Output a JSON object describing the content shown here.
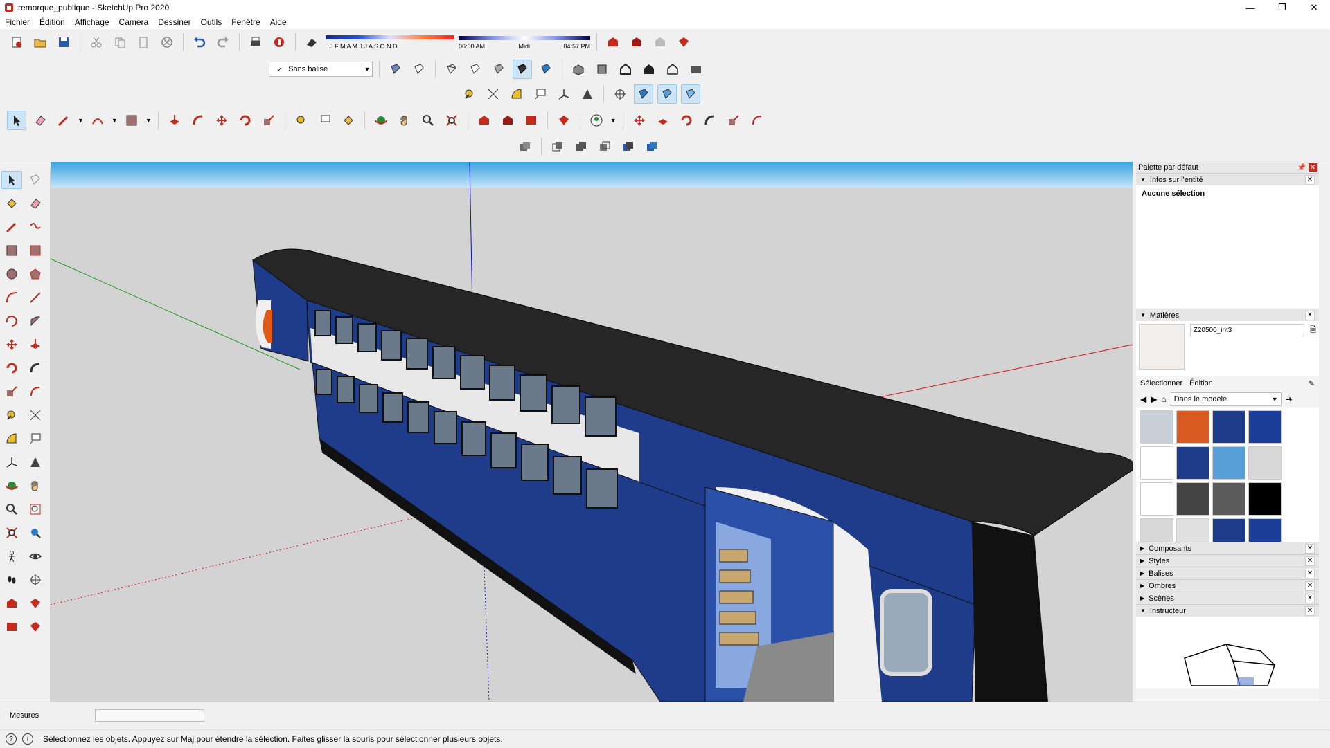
{
  "window": {
    "title": "remorque_publique - SketchUp Pro 2020"
  },
  "menu": [
    "Fichier",
    "Édition",
    "Affichage",
    "Caméra",
    "Dessiner",
    "Outils",
    "Fenêtre",
    "Aide"
  ],
  "toolbar": {
    "tag_select": "Sans balise",
    "months": "J F M A M J J A S O N D",
    "time_start": "06:50 AM",
    "time_mid": "Midi",
    "time_end": "04:57 PM"
  },
  "tray": {
    "title": "Palette par défaut",
    "entity_info": {
      "header": "Infos sur l'entité",
      "content": "Aucune sélection"
    },
    "materials": {
      "header": "Matières",
      "name": "Z20500_int3",
      "tab_select": "Sélectionner",
      "tab_edit": "Édition",
      "dropdown": "Dans le modèle",
      "swatches": [
        "#c8cfd6",
        "#d85a20",
        "#1e3c8a",
        "#1b3f98",
        "#ffffff",
        "#1e3c8a",
        "#5aa0d8",
        "#d8d8d8",
        "#ffffff",
        "#444444",
        "#5a5a5a",
        "#000000",
        "#d8d8d8",
        "#e0e0e0",
        "#1e3c8a",
        "#1b3f98"
      ]
    },
    "collapsed": [
      "Composants",
      "Styles",
      "Balises",
      "Ombres",
      "Scènes"
    ],
    "instructor": {
      "header": "Instructeur"
    }
  },
  "measures": {
    "label": "Mesures"
  },
  "status": {
    "message": "Sélectionnez les objets. Appuyez sur Maj pour étendre la sélection. Faites glisser la souris pour sélectionner plusieurs objets."
  },
  "colors": {
    "accent": "#c42b1c",
    "sky": "#3aa3de",
    "ground": "#d3d3d3",
    "train_blue": "#1e3c8a"
  }
}
